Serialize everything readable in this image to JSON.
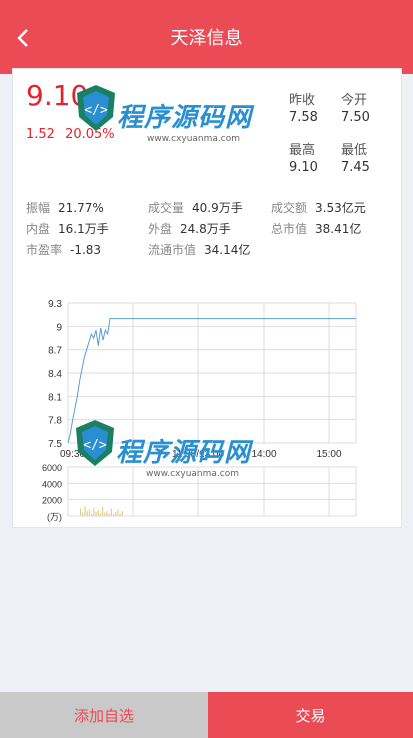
{
  "header": {
    "title": "天泽信息"
  },
  "quote": {
    "price": "9.10",
    "change": "1.52",
    "change_pct": "20.05%",
    "prev_close_label": "昨收",
    "prev_close": "7.58",
    "open_label": "今开",
    "open": "7.50",
    "high_label": "最高",
    "high": "9.10",
    "low_label": "最低",
    "low": "7.45"
  },
  "stats": [
    {
      "label": "振幅",
      "value": "21.77%"
    },
    {
      "label": "成交量",
      "value": "40.9万手"
    },
    {
      "label": "成交额",
      "value": "3.53亿元"
    },
    {
      "label": "内盘",
      "value": "16.1万手"
    },
    {
      "label": "外盘",
      "value": "24.8万手"
    },
    {
      "label": "总市值",
      "value": "38.41亿"
    },
    {
      "label": "市盈率",
      "value": "-1.83"
    },
    {
      "label": "流通市值",
      "value": "34.14亿"
    }
  ],
  "chart_data": {
    "type": "line",
    "y_ticks": [
      "9.3",
      "9",
      "8.7",
      "8.4",
      "8.1",
      "7.8",
      "7.5"
    ],
    "ylim": [
      7.5,
      9.3
    ],
    "x_ticks": [
      "09:30",
      "11:30/13:00",
      "14:00",
      "15:00"
    ],
    "series": [
      {
        "values": [
          7.5,
          7.62,
          7.8,
          7.95,
          8.1,
          8.3,
          8.45,
          8.6,
          8.7,
          8.8,
          8.9,
          8.85,
          8.95,
          8.75,
          8.98,
          8.82,
          8.95,
          8.9,
          9.1,
          9.1,
          9.1
        ]
      }
    ],
    "volume_ticks": [
      "6000",
      "4000",
      "2000",
      "(万)"
    ],
    "volume_ylim": [
      0,
      6000
    ]
  },
  "watermark": {
    "cn_text": "程序源码网",
    "url": "www.cxyuanma.com"
  },
  "buttons": {
    "watch": "添加自选",
    "trade": "交易"
  },
  "colors": {
    "accent": "#ea4b55",
    "up": "#e2242e",
    "line": "#5b9bd5"
  }
}
